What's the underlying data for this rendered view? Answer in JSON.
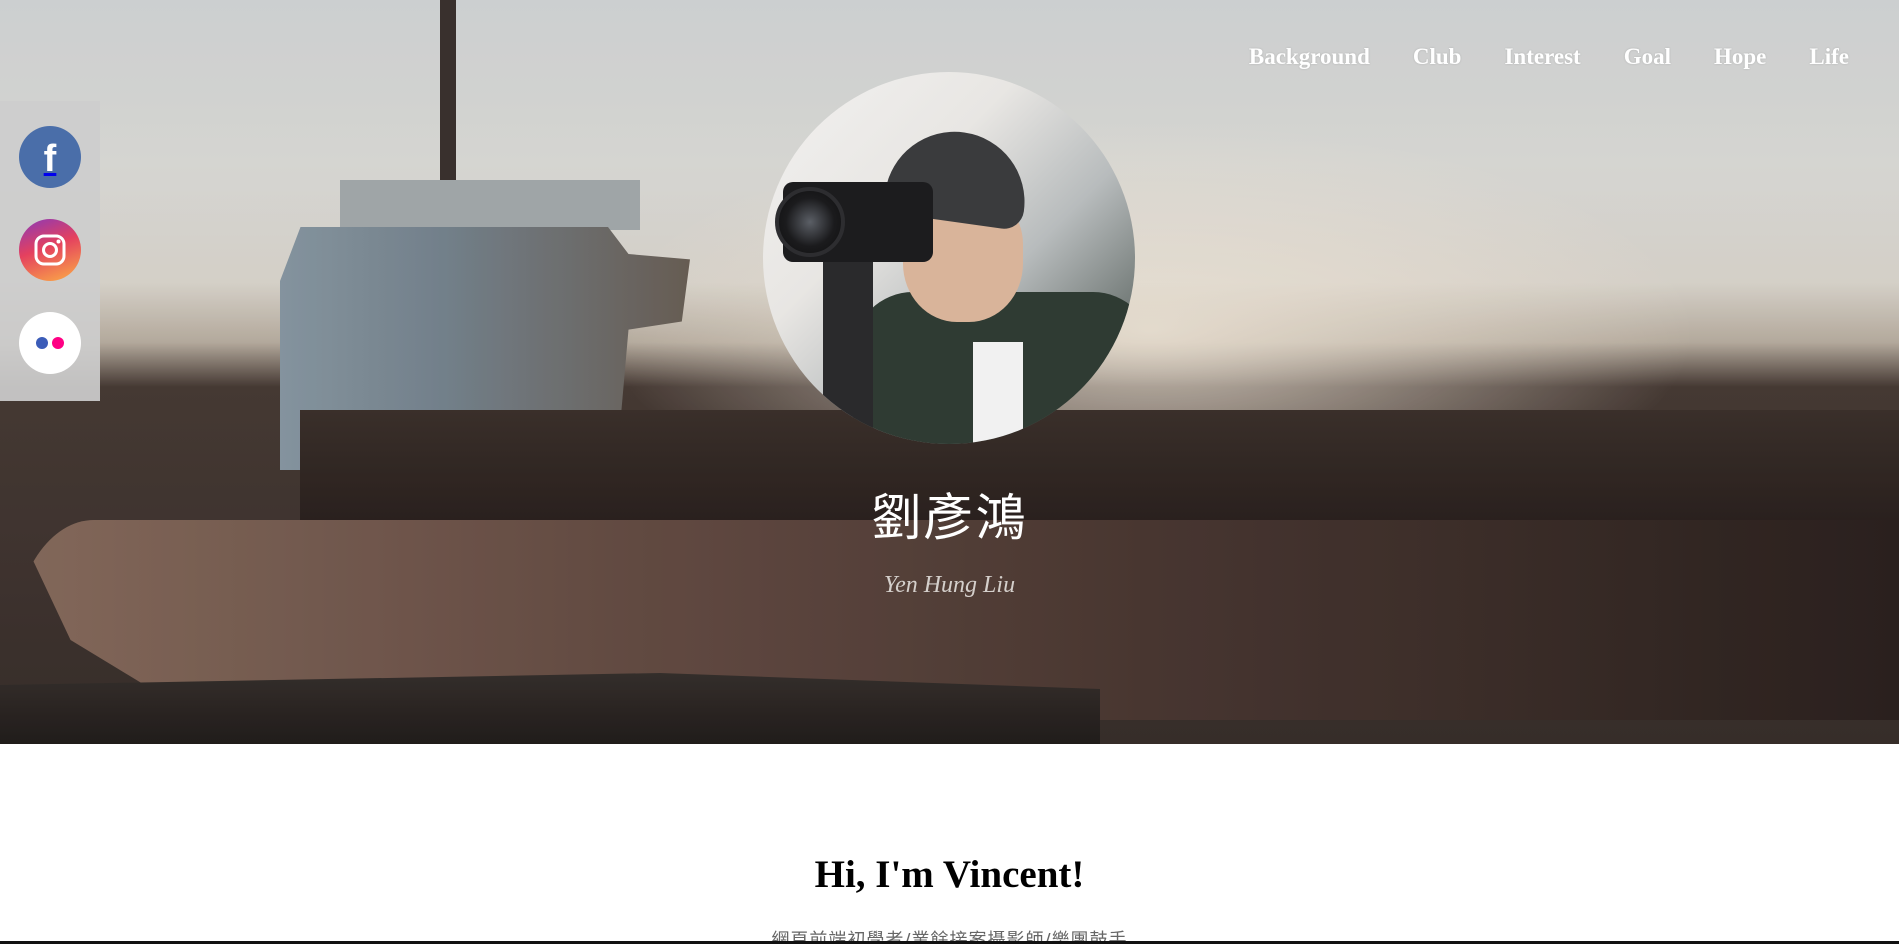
{
  "nav": {
    "items": [
      {
        "label": "Background"
      },
      {
        "label": "Club"
      },
      {
        "label": "Interest"
      },
      {
        "label": "Goal"
      },
      {
        "label": "Hope"
      },
      {
        "label": "Life"
      }
    ]
  },
  "social": {
    "facebook": {
      "icon": "facebook-icon",
      "glyph": "f",
      "color": "#4a6ea9"
    },
    "instagram": {
      "icon": "instagram-icon"
    },
    "flickr": {
      "icon": "flickr-icon",
      "colors": [
        "#3b5cb8",
        "#ff0084"
      ]
    }
  },
  "profile": {
    "name_zh": "劉彥鴻",
    "name_en": "Yen Hung Liu"
  },
  "intro": {
    "greeting": "Hi, I'm Vincent!",
    "tagline": "網頁前端初學者/業餘接案攝影師/樂團鼓手"
  }
}
